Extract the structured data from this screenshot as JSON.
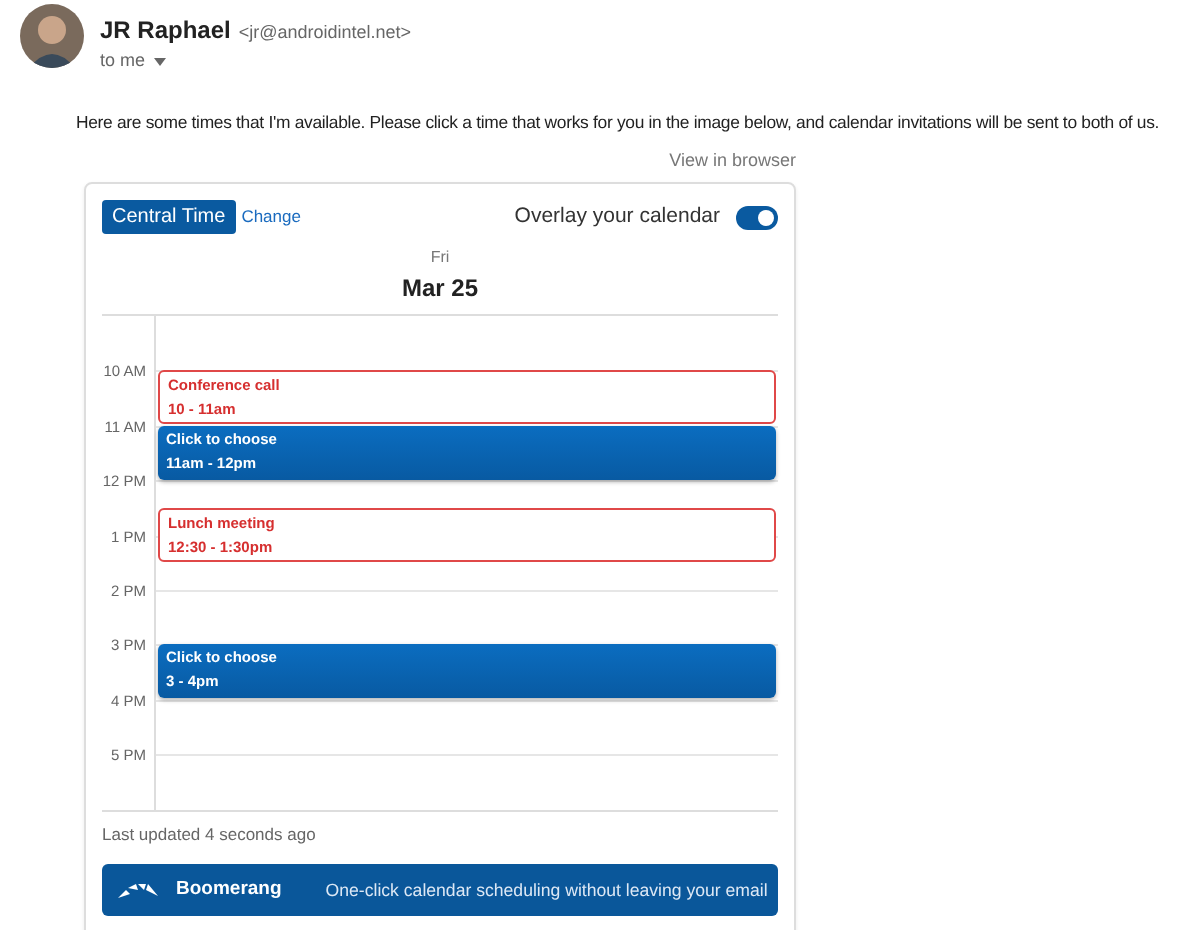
{
  "sender": {
    "name": "JR Raphael",
    "email": "<jr@androidintel.net>",
    "recipient": "to me"
  },
  "message": "Here are some times that I'm available. Please click a time that works for you in the image below, and calendar invitations will be sent to both of us.",
  "view_in_browser": "View in browser",
  "calendar": {
    "timezone": "Central Time",
    "change": "Change",
    "overlay": {
      "label": "Overlay your calendar",
      "on": true
    },
    "weekday": "Fri",
    "date": "Mar 25",
    "hours": [
      {
        "label": "10 AM",
        "events": [
          {
            "kind": "busy",
            "half_past": false,
            "title": "Conference call",
            "time": "10 - 11am"
          }
        ]
      },
      {
        "label": "11 AM",
        "events": [
          {
            "kind": "open",
            "half_past": false,
            "title": "Click to choose",
            "time": "11am - 12pm"
          }
        ]
      },
      {
        "label": "12 PM",
        "events": [
          {
            "kind": "busy",
            "half_past": true,
            "title": "Lunch meeting",
            "time": "12:30 - 1:30pm"
          }
        ]
      },
      {
        "label": "1 PM"
      },
      {
        "label": "2 PM"
      },
      {
        "label": "3 PM",
        "events": [
          {
            "kind": "open",
            "half_past": false,
            "title": "Click to choose",
            "time": "3 - 4pm"
          }
        ]
      },
      {
        "label": "4 PM"
      },
      {
        "label": "5 PM"
      }
    ],
    "updated": "Last updated 4 seconds ago"
  },
  "banner": {
    "brand": "Boomerang",
    "tagline": "One-click calendar scheduling without leaving your email"
  }
}
